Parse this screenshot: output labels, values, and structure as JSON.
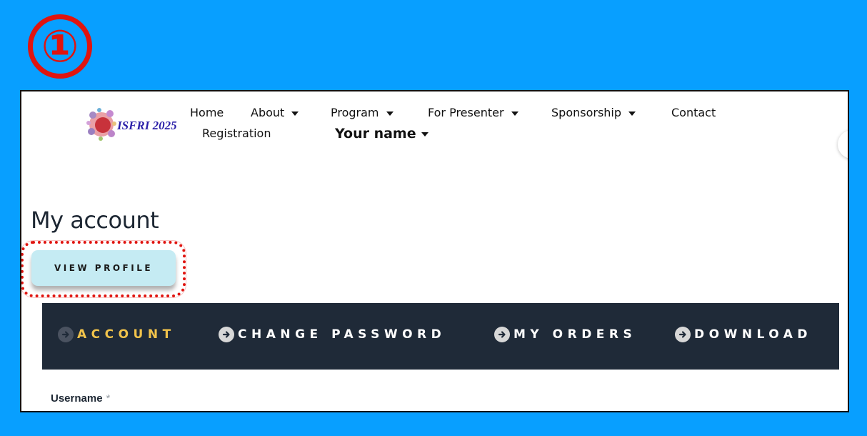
{
  "step_marker": "①",
  "header": {
    "logo_text": "ISFRI 2025",
    "nav": [
      {
        "label": "Home",
        "dropdown": false
      },
      {
        "label": "About",
        "dropdown": true
      },
      {
        "label": "Program",
        "dropdown": true
      },
      {
        "label": "For Presenter",
        "dropdown": true
      },
      {
        "label": "Sponsorship",
        "dropdown": true
      },
      {
        "label": "Contact",
        "dropdown": false
      },
      {
        "label": "Registration",
        "dropdown": false
      },
      {
        "label": "Your name",
        "dropdown": true
      }
    ]
  },
  "page": {
    "title": "My account",
    "view_profile_label": "VIEW PROFILE"
  },
  "tabs": [
    {
      "label": "ACCOUNT",
      "active": true
    },
    {
      "label": "CHANGE PASSWORD",
      "active": false
    },
    {
      "label": "MY ORDERS",
      "active": false
    },
    {
      "label": "DOWNLOAD",
      "active": false
    }
  ],
  "form": {
    "username_label": "Username",
    "required_mark": "*"
  },
  "colors": {
    "background": "#089fff",
    "highlight": "#e0140f",
    "tabbar": "#1f2a38",
    "active_tab": "#f1c34b",
    "button": "#c5ebf3"
  }
}
